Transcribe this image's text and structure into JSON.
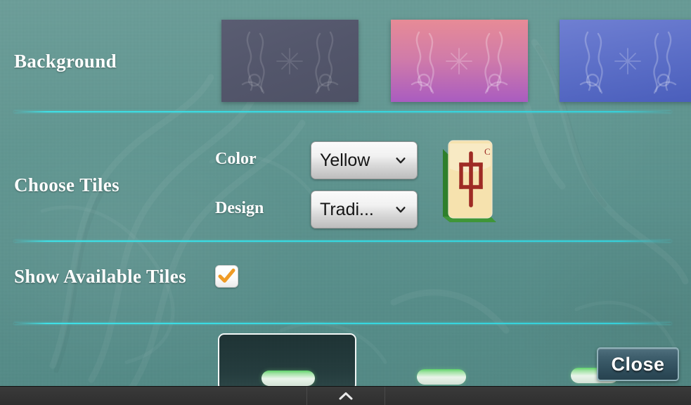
{
  "app": {
    "surface_color": "#5d9590",
    "divider_color": "#36d8e0"
  },
  "sections": {
    "background": {
      "label": "Background",
      "thumbnails": [
        {
          "name": "slate-background",
          "selected": false,
          "color_top": "#5a5d72",
          "color_bottom": "#4e5165"
        },
        {
          "name": "pink-purple-background",
          "selected": false,
          "color_top": "#e78b96",
          "color_bottom": "#a95cc0"
        },
        {
          "name": "blue-background",
          "selected": false,
          "color_top": "#6f7fd2",
          "color_bottom": "#4a5ebb"
        }
      ]
    },
    "choose_tiles": {
      "label": "Choose Tiles",
      "color": {
        "label": "Color",
        "value": "Yellow",
        "options": [
          "Yellow"
        ]
      },
      "design": {
        "label": "Design",
        "value": "Tradi...",
        "options": [
          "Tradi..."
        ]
      },
      "tile_preview": {
        "glyph": "中",
        "corner_mark": "C",
        "face_color": "#f8e7b5",
        "glyph_color": "#9e2b24",
        "edge_color": "#3f9638"
      }
    },
    "show_available_tiles": {
      "label": "Show Available Tiles",
      "checked": true,
      "check_color": "#ef9b26"
    }
  },
  "bottom": {
    "close_button": "Close"
  },
  "navbar": {
    "center_icon": "chevron-up-icon"
  }
}
